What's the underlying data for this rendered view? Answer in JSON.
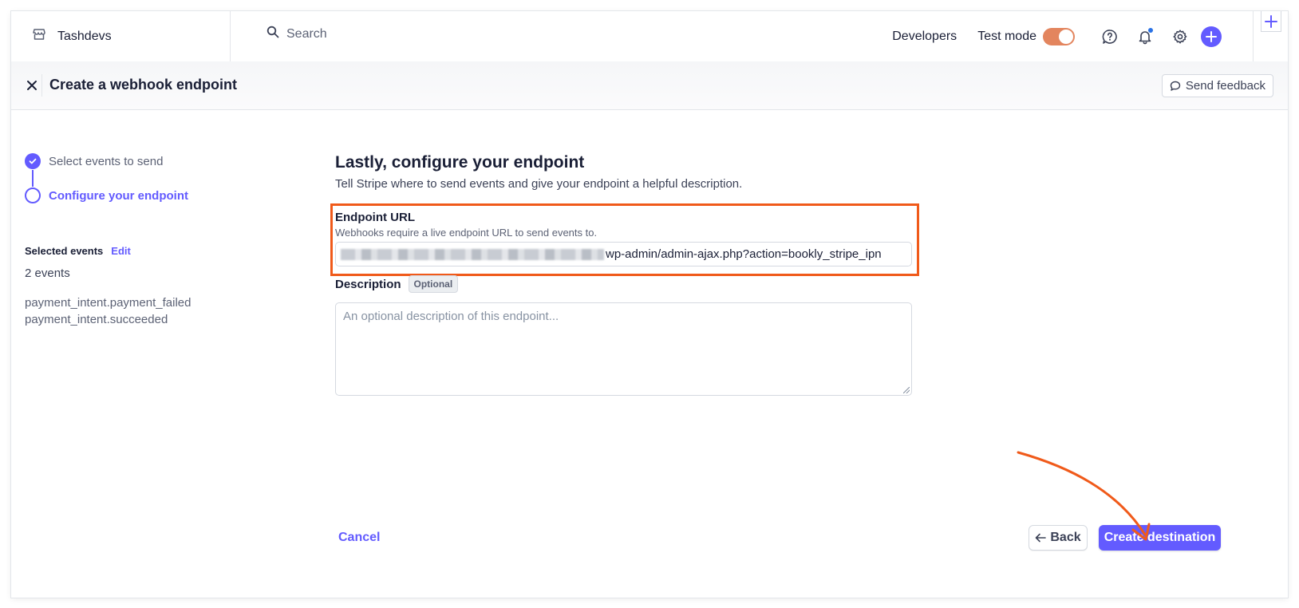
{
  "topbar": {
    "account_name": "Tashdevs",
    "search_placeholder": "Search",
    "developers_label": "Developers",
    "test_mode_label": "Test mode",
    "test_mode_on": true
  },
  "header": {
    "title": "Create a webhook endpoint",
    "feedback_label": "Send feedback"
  },
  "steps": [
    {
      "label": "Select events to send",
      "state": "done"
    },
    {
      "label": "Configure your endpoint",
      "state": "active"
    }
  ],
  "selected_events": {
    "title": "Selected events",
    "edit_label": "Edit",
    "count": "2 events",
    "items": [
      "payment_intent.payment_failed",
      "payment_intent.succeeded"
    ]
  },
  "form": {
    "title": "Lastly, configure your endpoint",
    "subtitle": "Tell Stripe where to send events and give your endpoint a helpful description.",
    "url_label": "Endpoint URL",
    "url_help": "Webhooks require a live endpoint URL to send events to.",
    "url_value_visible": "wp-admin/admin-ajax.php?action=bookly_stripe_ipn",
    "description_label": "Description",
    "optional_badge": "Optional",
    "description_placeholder": "An optional description of this endpoint..."
  },
  "actions": {
    "cancel_label": "Cancel",
    "back_label": "Back",
    "create_label": "Create destination"
  },
  "colors": {
    "accent": "#635bff",
    "highlight": "#f05a1a",
    "toggle": "#e3855e"
  }
}
